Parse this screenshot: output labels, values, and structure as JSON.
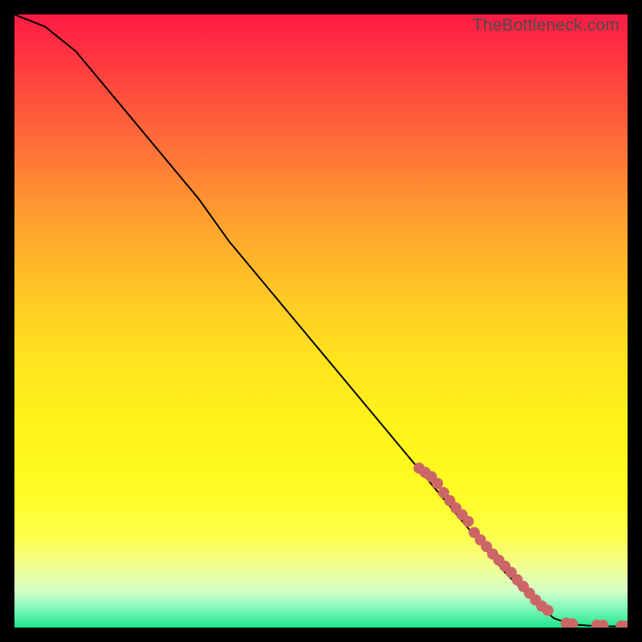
{
  "watermark": "TheBottleneck.com",
  "chart_data": {
    "type": "line",
    "title": "",
    "xlabel": "",
    "ylabel": "",
    "xlim": [
      0,
      100
    ],
    "ylim": [
      0,
      100
    ],
    "series": [
      {
        "name": "curve",
        "x": [
          0,
          5,
          10,
          15,
          20,
          25,
          30,
          35,
          40,
          45,
          50,
          55,
          60,
          65,
          70,
          75,
          80,
          85,
          88,
          91,
          94,
          97,
          100
        ],
        "y": [
          100,
          98,
          94,
          88,
          82,
          76,
          70,
          63,
          57,
          51,
          45,
          39,
          33,
          27,
          21,
          15,
          9,
          4,
          1.5,
          0.5,
          0.3,
          0.2,
          0.2
        ]
      },
      {
        "name": "dots",
        "x": [
          66,
          67,
          68,
          69,
          70,
          71,
          72,
          73,
          74,
          75,
          76,
          77,
          78,
          79,
          80,
          81,
          82,
          83,
          84,
          85,
          86,
          87,
          90,
          91,
          95,
          96,
          99,
          100
        ],
        "y": [
          26,
          25.3,
          24.6,
          23.5,
          22,
          20.7,
          19.5,
          18.4,
          17.3,
          15.5,
          14.3,
          13.2,
          12,
          11,
          10,
          9,
          7.8,
          6.7,
          5.6,
          4.5,
          3.5,
          2.8,
          0.7,
          0.6,
          0.4,
          0.35,
          0.25,
          0.25
        ]
      }
    ],
    "colors": {
      "curve": "#000000",
      "dots": "#cc6666"
    }
  }
}
